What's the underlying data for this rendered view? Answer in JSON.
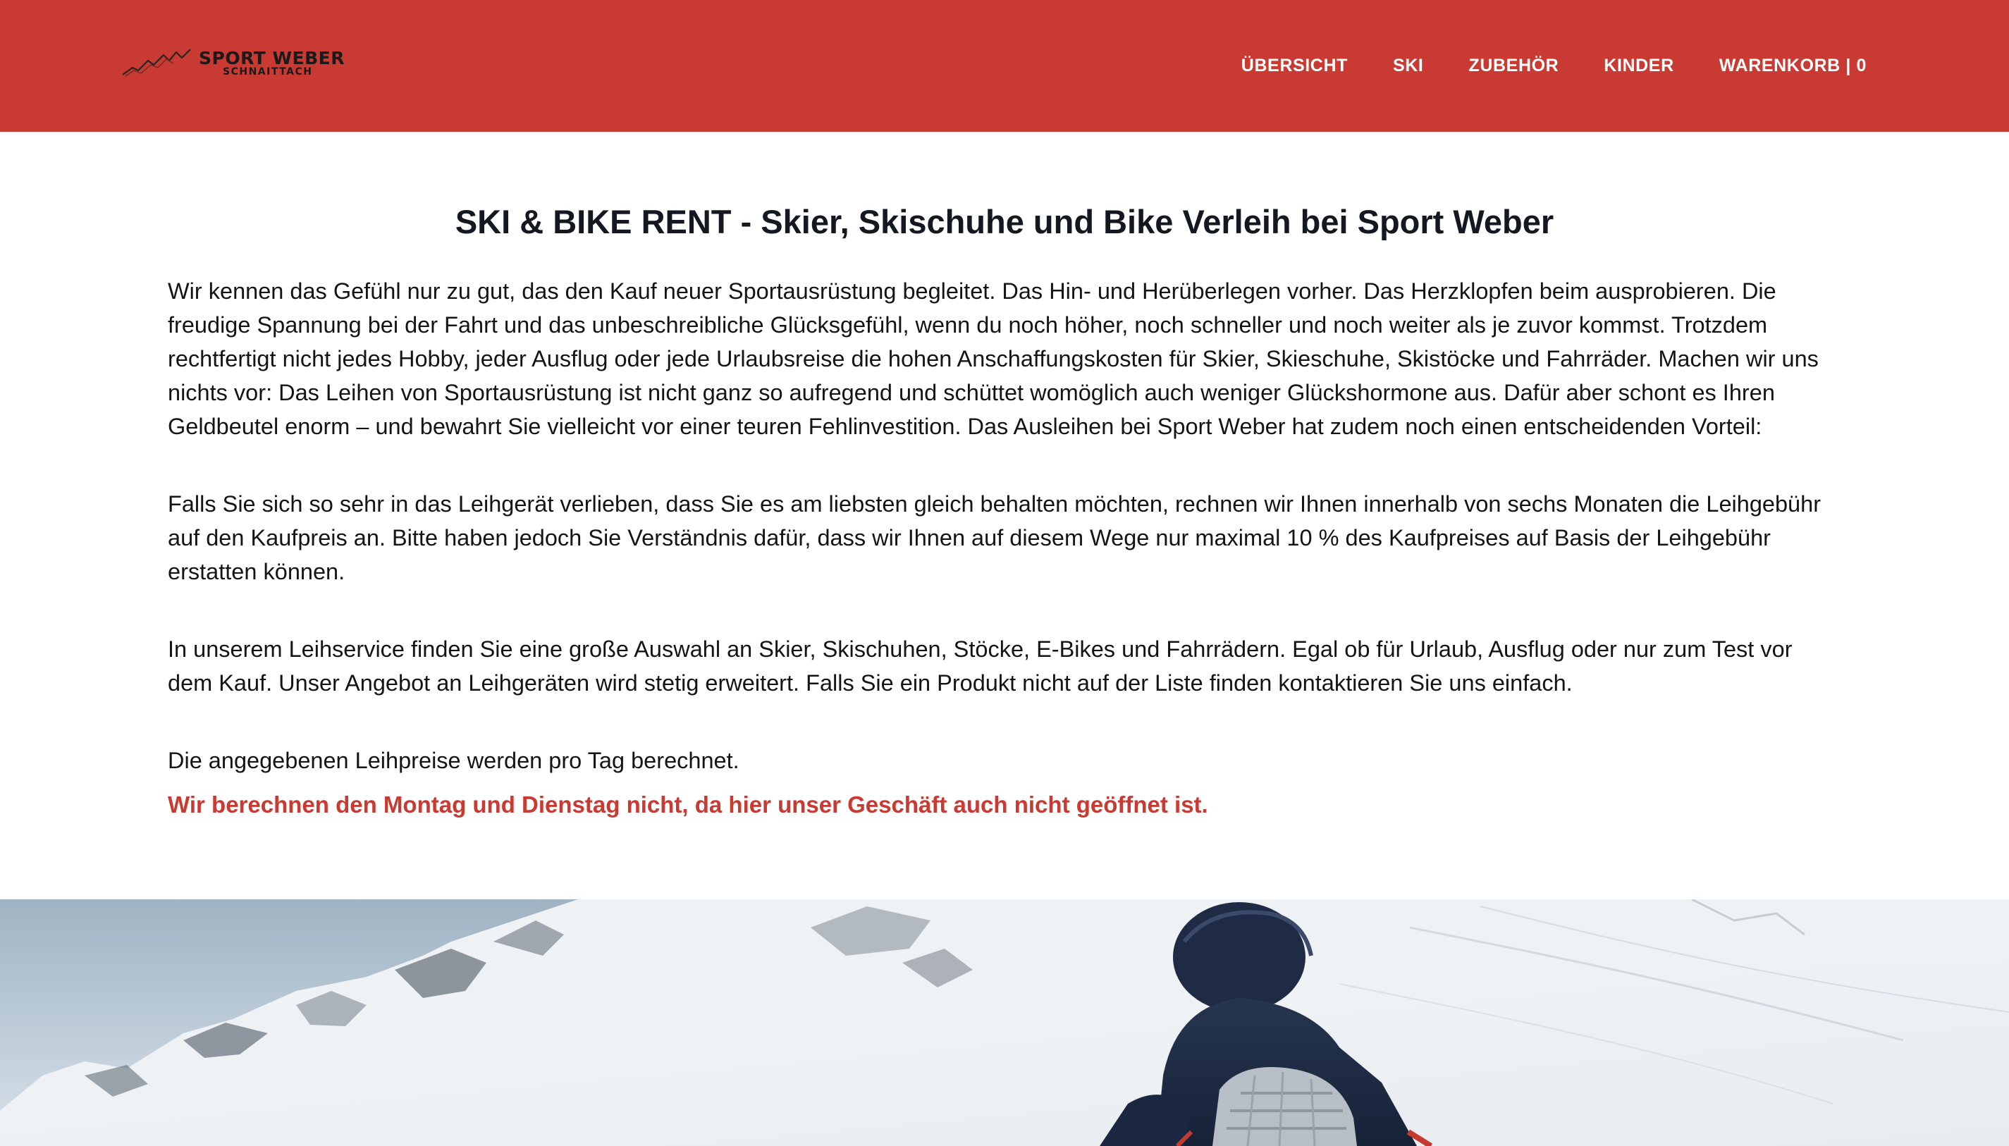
{
  "header": {
    "logo": {
      "name": "SPORT WEBER",
      "location": "SCHNAITTACH"
    },
    "nav": [
      {
        "label": "ÜBERSICHT"
      },
      {
        "label": "SKI"
      },
      {
        "label": "ZUBEHÖR"
      },
      {
        "label": "KINDER"
      },
      {
        "label": "WARENKORB | 0"
      }
    ]
  },
  "main": {
    "title": "SKI & BIKE RENT - Skier, Skischuhe und Bike Verleih bei Sport Weber",
    "paragraphs": [
      "Wir kennen das Gefühl nur zu gut, das den Kauf neuer Sportausrüstung begleitet. Das Hin- und Herüberlegen vorher. Das Herzklopfen beim ausprobieren. Die freudige Spannung bei der Fahrt und das unbeschreibliche Glücksgefühl, wenn du noch höher, noch schneller und noch weiter als je zuvor kommst. Trotzdem rechtfertigt nicht jedes Hobby, jeder Ausflug oder jede Urlaubsreise die hohen Anschaffungskosten für Skier, Skieschuhe, Skistöcke und Fahrräder. Machen wir uns nichts vor: Das Leihen von Sportausrüstung ist nicht ganz so aufregend und schüttet womöglich auch weniger Glückshormone aus. Dafür aber schont es Ihren Geldbeutel enorm – und bewahrt Sie vielleicht vor einer teuren Fehlinvestition. Das Ausleihen bei Sport Weber hat zudem noch einen entscheidenden Vorteil:",
      "Falls Sie sich so sehr in das Leihgerät verlieben, dass Sie es am liebsten gleich behalten möchten, rechnen wir Ihnen innerhalb von sechs Monaten die Leihgebühr auf den Kaufpreis an. Bitte haben jedoch Sie Verständnis dafür, dass wir Ihnen auf diesem Wege nur maximal 10 % des Kaufpreises auf Basis der Leihgebühr erstatten können.",
      "In unserem Leihservice finden Sie eine große Auswahl an Skier, Skischuhen, Stöcke, E-Bikes und Fahrrädern. Egal ob für Urlaub, Ausflug oder nur zum Test vor dem Kauf. Unser Angebot an Leihgeräten wird stetig erweitert. Falls Sie ein Produkt nicht auf der Liste finden kontaktieren Sie uns einfach.",
      "Die angegebenen Leihpreise werden pro Tag berechnet."
    ],
    "notice": "Wir berechnen den Montag und Dienstag nicht, da hier unser Geschäft auch nicht geöffnet ist."
  },
  "colors": {
    "header_bg": "#c93a32",
    "nav_text": "#ffffff",
    "notice_text": "#c83a32",
    "body_text": "#141414"
  },
  "icons": {
    "logo_mark": "mountain-logo-icon"
  }
}
